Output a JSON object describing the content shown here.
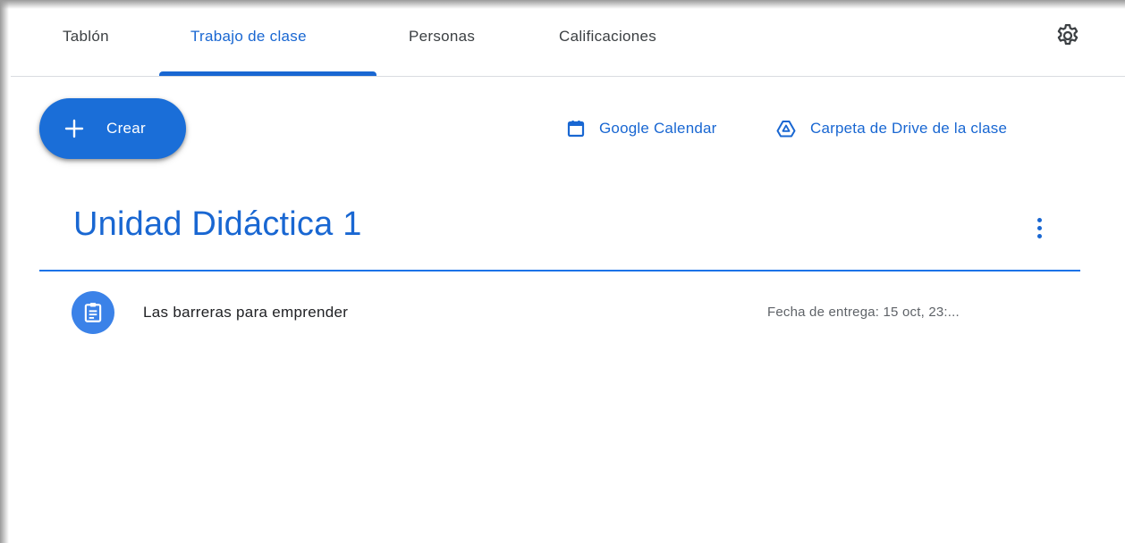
{
  "tabs": [
    {
      "label": "Tablón"
    },
    {
      "label": "Trabajo de clase"
    },
    {
      "label": "Personas"
    },
    {
      "label": "Calificaciones"
    }
  ],
  "active_tab": "Trabajo de clase",
  "settings_icon": "gear-icon",
  "create_button": {
    "label": "Crear",
    "icon": "plus-icon"
  },
  "links": {
    "calendar": {
      "label": "Google Calendar",
      "icon": "calendar-icon"
    },
    "drive": {
      "label": "Carpeta de Drive de la clase",
      "icon": "drive-icon"
    }
  },
  "topic": {
    "title": "Unidad Didáctica 1",
    "menu_icon": "more-vert-icon",
    "items": [
      {
        "title": "Las barreras para emprender",
        "due": "Fecha de entrega: 15 oct, 23:...",
        "icon": "assignment-icon"
      }
    ]
  },
  "colors": {
    "accent": "#1967d2",
    "button": "#1a6ed8",
    "text": "#3c4043",
    "divider": "#1a73e8"
  }
}
